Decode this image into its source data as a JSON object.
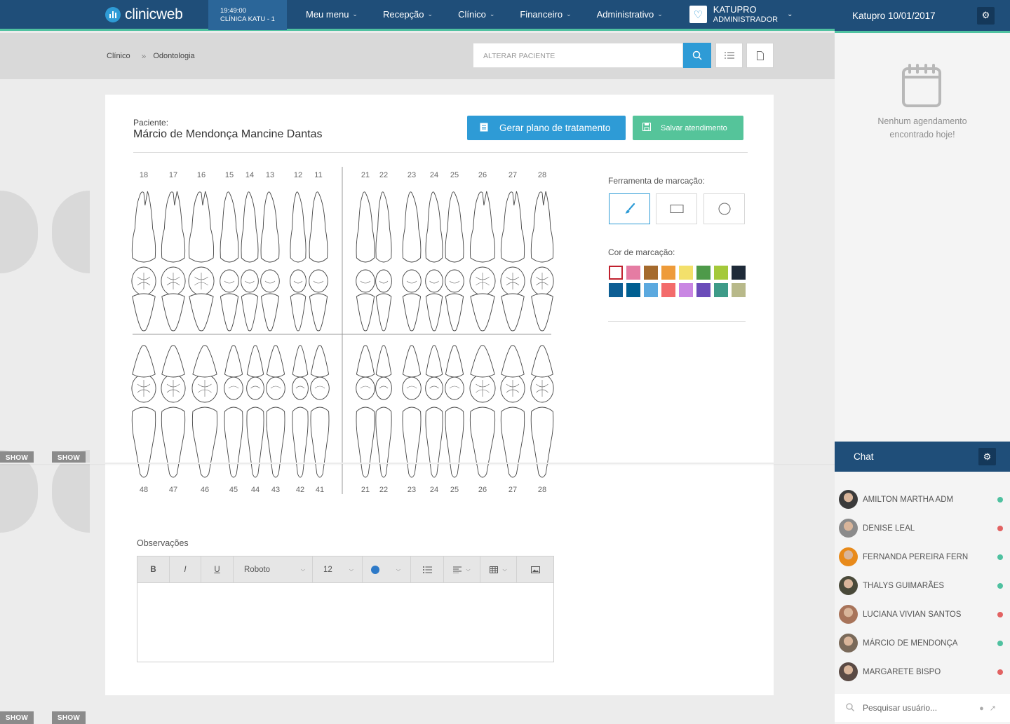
{
  "topbar": {
    "brand": "clinicweb",
    "clock_time": "19:49:00",
    "clinic": "CLÍNICA KATU - 1",
    "menu": [
      {
        "label": "Meu menu"
      },
      {
        "label": "Recepção"
      },
      {
        "label": "Clínico"
      },
      {
        "label": "Financeiro"
      },
      {
        "label": "Administrativo"
      }
    ],
    "user_name": "KATUPRO",
    "user_role": "ADMINISTRADOR"
  },
  "breadcrumb": {
    "items": [
      "Clínico",
      "Odontologia"
    ]
  },
  "search": {
    "placeholder": "ALTERAR PACIENTE"
  },
  "patient": {
    "label": "Paciente:",
    "name": "Márcio de Mendonça Mancine Dantas"
  },
  "actions": {
    "plan": "Gerar plano de tratamento",
    "save": "Salvar atendimento"
  },
  "odontogram": {
    "upper_left": [
      "18",
      "17",
      "16",
      "15",
      "14",
      "13",
      "12",
      "11"
    ],
    "upper_right": [
      "21",
      "22",
      "23",
      "24",
      "25",
      "26",
      "27",
      "28"
    ],
    "lower_left": [
      "48",
      "47",
      "46",
      "45",
      "44",
      "43",
      "42",
      "41"
    ],
    "lower_right": [
      "21",
      "22",
      "23",
      "24",
      "25",
      "26",
      "27",
      "28"
    ]
  },
  "markup": {
    "tool_label": "Ferramenta de marcação:",
    "tools": [
      "brush",
      "rectangle",
      "circle"
    ],
    "color_label": "Cor de marcação:",
    "colors": [
      "#ffffff",
      "#e57ca3",
      "#a56a2d",
      "#ee9b3a",
      "#f3e06b",
      "#4e9a4a",
      "#a4c93b",
      "#1e2a38",
      "#0d5e94",
      "#005f91",
      "#5ba9df",
      "#f36b6b",
      "#c986e3",
      "#6b4cb9",
      "#3e9b88",
      "#b8b98a"
    ]
  },
  "observations": {
    "label": "Observações",
    "font": "Roboto",
    "size": "12",
    "bold": "B",
    "italic": "I",
    "underline": "U"
  },
  "side_show": "SHOW",
  "right_panel": {
    "date_title": "Katupro 10/01/2017",
    "no_schedule": "Nenhum agendamento encontrado hoje!",
    "chat_title": "Chat",
    "users": [
      {
        "name": "AMILTON MARTHA ADM",
        "status": "#4fc1a0",
        "avatar": "#3b3b3b"
      },
      {
        "name": "DENISE LEAL",
        "status": "#e26262",
        "avatar": "#8b8b8b"
      },
      {
        "name": "FERNANDA PEREIRA FERN",
        "status": "#4fc1a0",
        "avatar": "#e88a1a"
      },
      {
        "name": "THALYS GUIMARÃES",
        "status": "#4fc1a0",
        "avatar": "#4a4a3a"
      },
      {
        "name": "LUCIANA VIVIAN SANTOS",
        "status": "#e26262",
        "avatar": "#a8745a"
      },
      {
        "name": "MÁRCIO DE MENDONÇA",
        "status": "#4fc1a0",
        "avatar": "#7a6a5a"
      },
      {
        "name": "MARGARETE BISPO",
        "status": "#e26262",
        "avatar": "#5a4a44"
      }
    ],
    "search_placeholder": "Pesquisar usuário..."
  }
}
